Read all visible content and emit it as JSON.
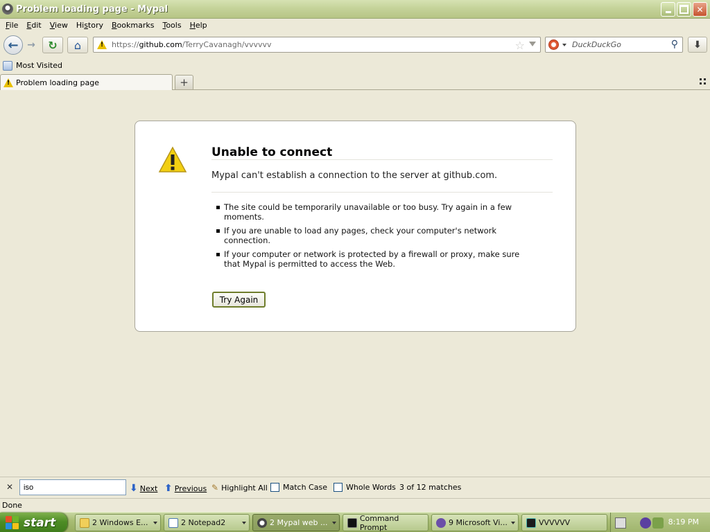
{
  "window": {
    "title": "Problem loading page - Mypal"
  },
  "menu": [
    "File",
    "Edit",
    "View",
    "History",
    "Bookmarks",
    "Tools",
    "Help"
  ],
  "menu_access_keys": [
    "F",
    "E",
    "V",
    "H",
    "B",
    "T",
    "H"
  ],
  "nav": {
    "url_prefix": "https://",
    "url_host": "github.com",
    "url_path": "/TerryCavanagh/vvvvvv",
    "search_placeholder": "DuckDuckGo"
  },
  "bookmarks": [
    "Most Visited"
  ],
  "tabs": [
    {
      "label": "Problem loading page",
      "icon": "warning-icon"
    }
  ],
  "error": {
    "title": "Unable to connect",
    "short_desc": "Mypal can't establish a connection to the server at github.com.",
    "items": [
      "The site could be temporarily unavailable or too busy. Try again in a few moments.",
      "If you are unable to load any pages, check your computer's network connection.",
      "If your computer or network is protected by a firewall or proxy, make sure that Mypal is permitted to access the Web."
    ],
    "try_again": "Try Again"
  },
  "findbar": {
    "query": "iso",
    "next": "Next",
    "previous": "Previous",
    "highlight_all": "Highlight All",
    "match_case": "Match Case",
    "whole_words": "Whole Words",
    "status": "3 of 12 matches"
  },
  "status": "Done",
  "taskbar": {
    "start": "start",
    "tasks": [
      {
        "label": "2 Windows E...",
        "icon": "folder-icon"
      },
      {
        "label": "2 Notepad2",
        "icon": "notepad-icon"
      },
      {
        "label": "2 Mypal web ...",
        "icon": "mypal-icon",
        "active": true
      },
      {
        "label": "Command Prompt",
        "icon": "cmd-icon"
      },
      {
        "label": "9 Microsoft Vi...",
        "icon": "visual-studio-icon"
      },
      {
        "label": "VVVVVV",
        "icon": "vvvvvv-icon"
      }
    ],
    "clock": "8:19 PM"
  },
  "colors": {
    "titlebar": "#c5d39a",
    "taskbar": "#a9bd74",
    "start": "#4e8d25",
    "warning": "#e8c000",
    "link_blue": "#2d63c7"
  }
}
